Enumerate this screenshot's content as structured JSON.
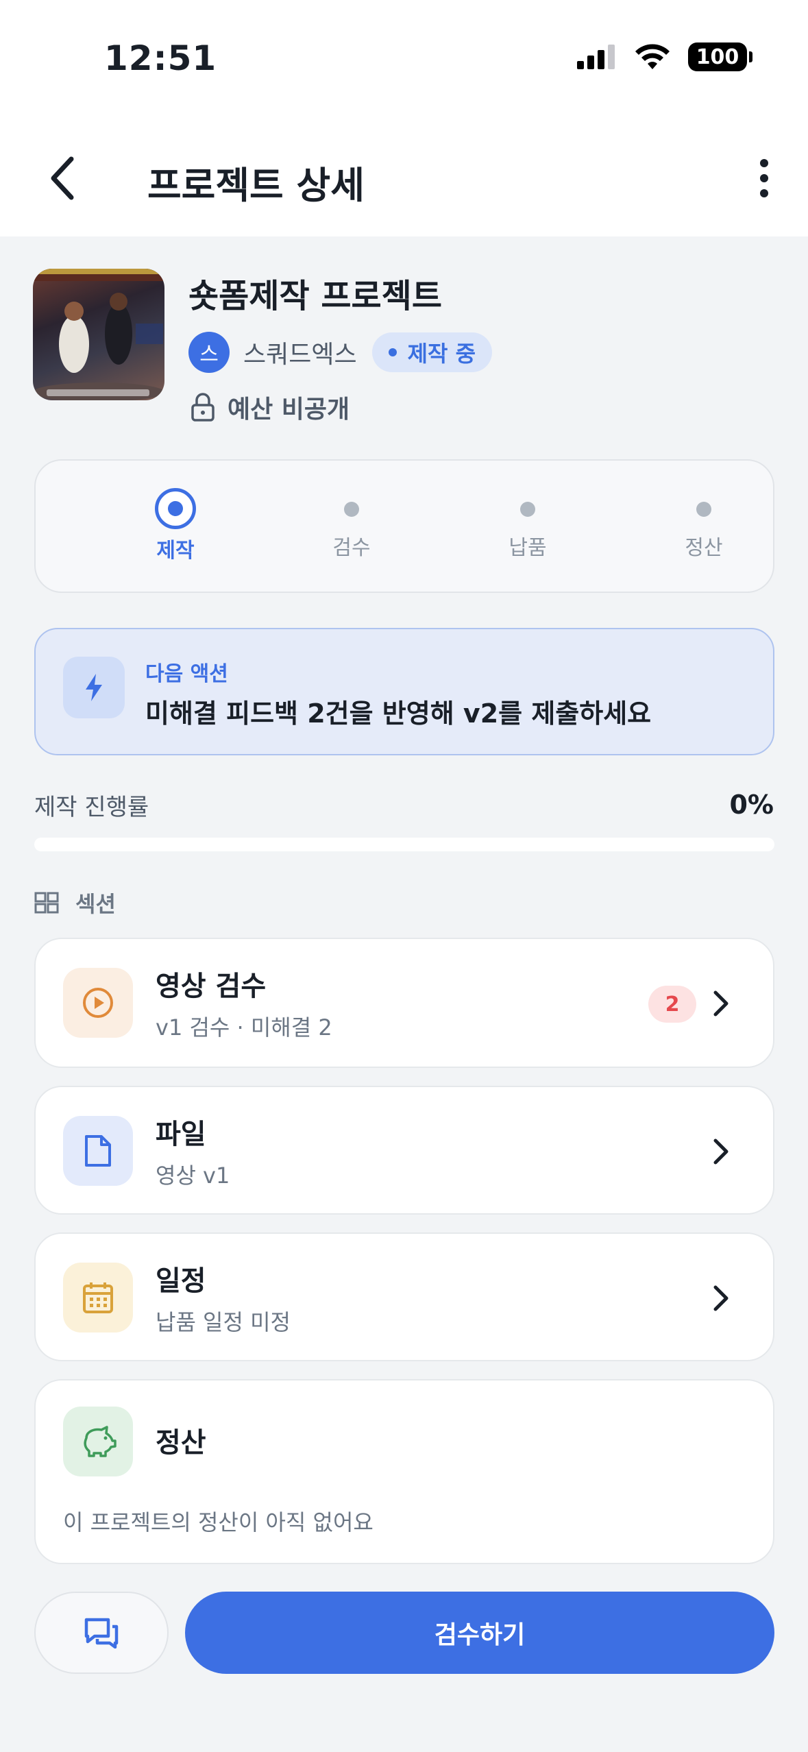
{
  "status_bar": {
    "time": "12:51",
    "battery": "100"
  },
  "header": {
    "title": "프로젝트 상세"
  },
  "project": {
    "title": "숏폼제작 프로젝트",
    "company_initial": "스",
    "company_name": "스쿼드엑스",
    "status": "제작 중",
    "budget": "예산 비공개"
  },
  "steps": [
    {
      "label": "제작",
      "active": true
    },
    {
      "label": "검수",
      "active": false
    },
    {
      "label": "납품",
      "active": false
    },
    {
      "label": "정산",
      "active": false
    }
  ],
  "next_action": {
    "label": "다음 액션",
    "text": "미해결 피드백 2건을 반영해 v2를 제출하세요"
  },
  "progress": {
    "label": "제작 진행률",
    "value_text": "0%",
    "value": 0
  },
  "sections": {
    "label": "섹션",
    "items": [
      {
        "title": "영상 검수",
        "subtitle": "v1 검수 · 미해결 2",
        "badge": "2",
        "icon": "play-circle-icon"
      },
      {
        "title": "파일",
        "subtitle": "영상 v1",
        "icon": "file-icon"
      },
      {
        "title": "일정",
        "subtitle": "납품 일정 미정",
        "icon": "calendar-icon"
      },
      {
        "title": "정산",
        "subtitle": "이 프로젝트의 정산이 아직 없어요",
        "icon": "piggy-bank-icon"
      }
    ]
  },
  "actions": {
    "primary": "검수하기"
  },
  "colors": {
    "accent": "#3d6fe3",
    "badge_red": "#e5484d"
  }
}
